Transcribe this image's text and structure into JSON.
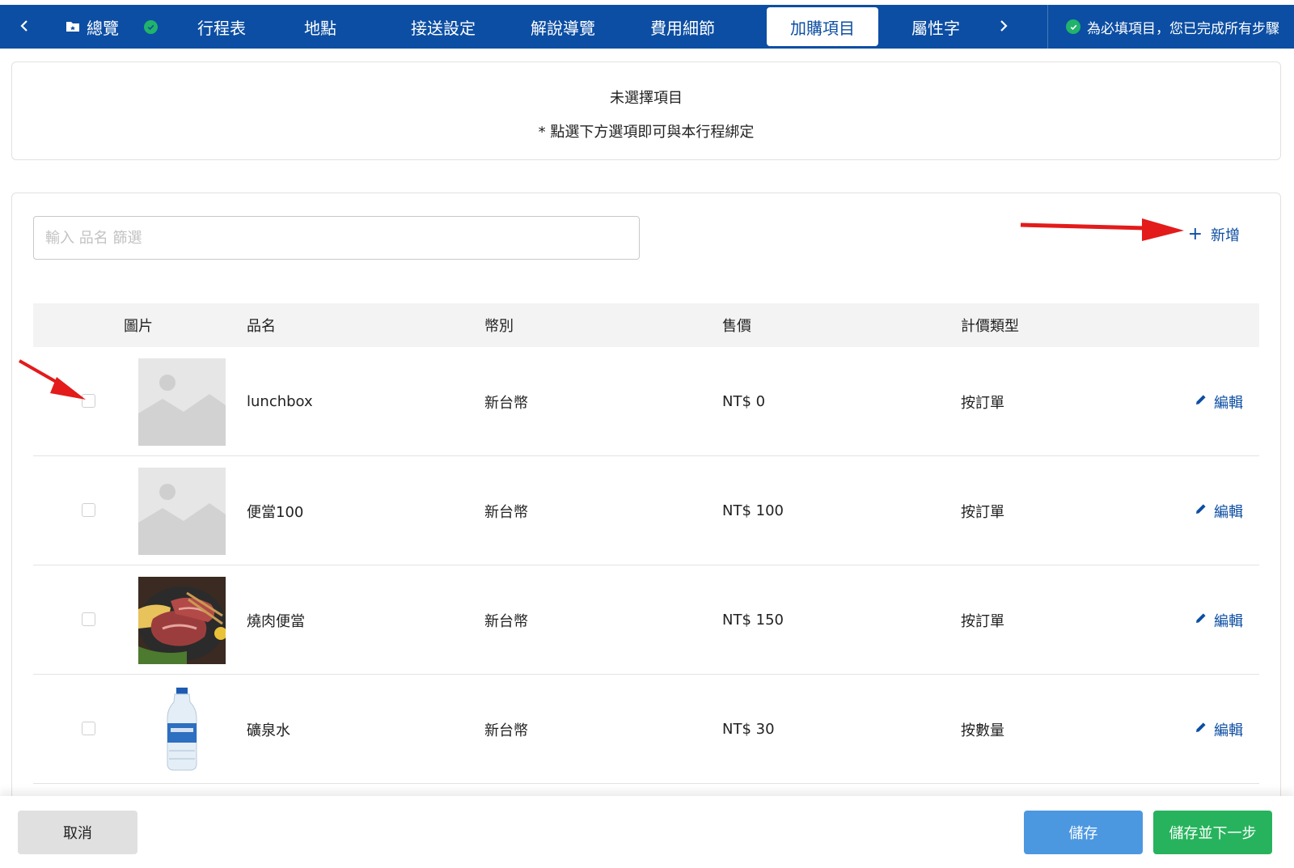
{
  "nav": {
    "back_icon": "chevron-left-icon",
    "overview_label": "總覽",
    "tabs": [
      {
        "label": "行程表"
      },
      {
        "label": "地點"
      },
      {
        "label": "接送設定"
      },
      {
        "label": "解說導覽"
      },
      {
        "label": "費用細節"
      },
      {
        "label": "加購項目"
      },
      {
        "label": "屬性字"
      }
    ],
    "active_tab": "加購項目",
    "status_text": "為必填項目，您已完成所有步驟",
    "accent_color": "#0c4ea3",
    "success_color": "#21b36b"
  },
  "selection_info": {
    "title": "未選擇項目",
    "hint": "* 點選下方選項即可與本行程綁定"
  },
  "toolbar": {
    "search_placeholder": "輸入 品名 篩選",
    "add_label": "新增"
  },
  "table": {
    "headers": [
      "圖片",
      "品名",
      "幣別",
      "售價",
      "計價類型"
    ],
    "rows": [
      {
        "image": "placeholder-image",
        "name": "lunchbox",
        "currency": "新台幣",
        "price": "NT$ 0",
        "pricing_type": "按訂單",
        "edit_label": "編輯",
        "checked": false
      },
      {
        "image": "placeholder-image",
        "name": "便當100",
        "currency": "新台幣",
        "price": "NT$ 100",
        "pricing_type": "按訂單",
        "edit_label": "編輯",
        "checked": false
      },
      {
        "image": "grilled-meat-photo",
        "name": "燒肉便當",
        "currency": "新台幣",
        "price": "NT$ 150",
        "pricing_type": "按訂單",
        "edit_label": "編輯",
        "checked": false
      },
      {
        "image": "water-bottle-photo",
        "name": "礦泉水",
        "currency": "新台幣",
        "price": "NT$ 30",
        "pricing_type": "按數量",
        "edit_label": "編輯",
        "checked": false
      }
    ]
  },
  "footer": {
    "cancel_label": "取消",
    "save_label": "儲存",
    "save_next_label": "儲存並下一步"
  }
}
